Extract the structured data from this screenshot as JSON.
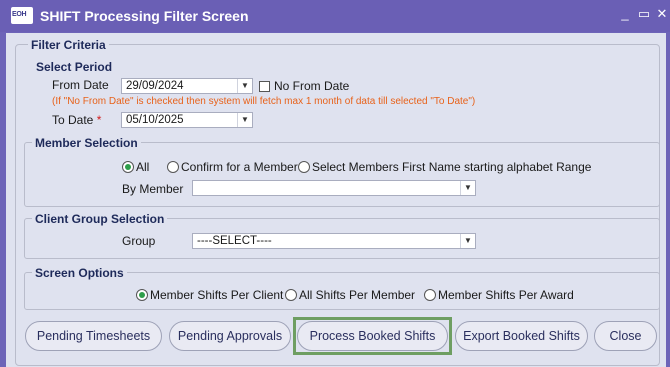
{
  "window": {
    "logo_text": "EOH",
    "title": "SHIFT Processing Filter Screen",
    "minimize_glyph": "_",
    "maximize_glyph": "▭",
    "close_glyph": "✕"
  },
  "filter": {
    "title": "Filter Criteria",
    "period": {
      "title": "Select Period",
      "from_label": "From Date",
      "from_value": "29/09/2024",
      "no_from_label": "No From Date",
      "no_from_checked": false,
      "hint": "(If \"No From Date\" is checked then system will fetch max 1 month of data till selected \"To Date\")",
      "to_label": "To Date",
      "required_marker": "*",
      "to_value": "05/10/2025"
    },
    "member": {
      "title": "Member Selection",
      "options": [
        "All",
        "Confirm for a Member",
        "Select Members First Name starting alphabet Range"
      ],
      "selected": "All",
      "by_member_label": "By Member",
      "by_member_value": ""
    },
    "client": {
      "title": "Client Group Selection",
      "group_label": "Group",
      "group_value": "----SELECT----"
    },
    "screen": {
      "title": "Screen Options",
      "options": [
        "Member Shifts Per Client",
        "All Shifts Per Member",
        "Member Shifts Per Award"
      ],
      "selected": "Member Shifts Per Client"
    }
  },
  "buttons": {
    "pending_timesheets": "Pending Timesheets",
    "pending_approvals": "Pending Approvals",
    "process_booked_shifts": "Process Booked Shifts",
    "export_booked_shifts": "Export Booked Shifts",
    "close": "Close"
  },
  "colors": {
    "titlebar": "#6a5fb5",
    "panel": "#dfe2ef",
    "hint": "#e8621a",
    "radio_selected": "#2e9e4a",
    "highlight_border": "#6e9e62"
  }
}
